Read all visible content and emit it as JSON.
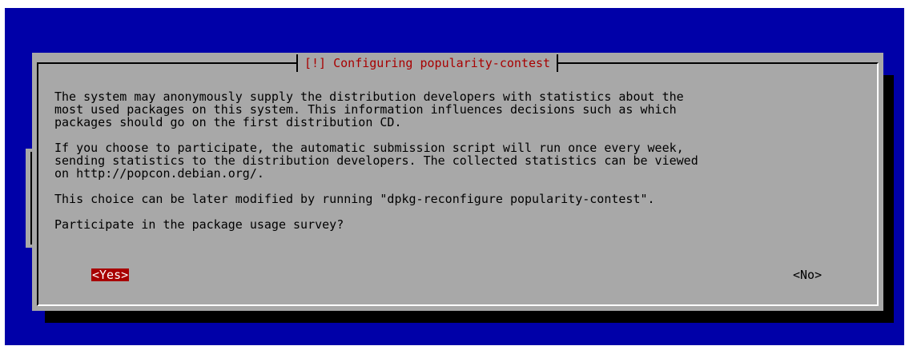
{
  "dialog": {
    "title": "[!] Configuring popularity-contest",
    "paragraphs": [
      "The system may anonymously supply the distribution developers with statistics about the\nmost used packages on this system. This information influences decisions such as which\npackages should go on the first distribution CD.",
      "If you choose to participate, the automatic submission script will run once every week,\nsending statistics to the distribution developers. The collected statistics can be viewed\non http://popcon.debian.org/.",
      "This choice can be later modified by running \"dpkg-reconfigure popularity-contest\"."
    ],
    "question": "Participate in the package usage survey?",
    "yes_label": "<Yes>",
    "no_label": "<No>"
  },
  "colors": {
    "background": "#0000a8",
    "dialog": "#a8a8a8",
    "accent": "#a80000"
  }
}
